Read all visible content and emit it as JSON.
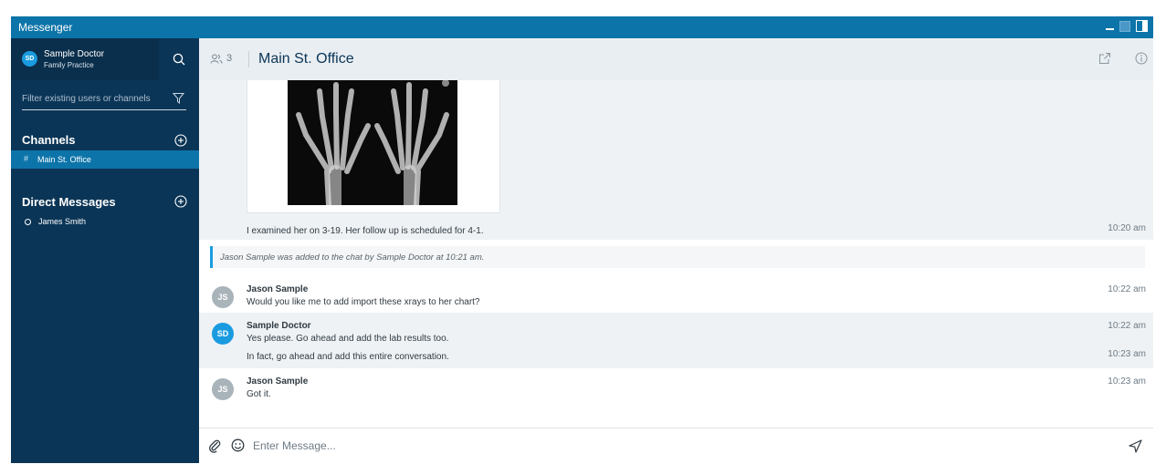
{
  "window": {
    "title": "Messenger"
  },
  "profile": {
    "initials": "SD",
    "name": "Sample Doctor",
    "role": "Family Practice"
  },
  "filter": {
    "placeholder": "Filter existing users or channels"
  },
  "channels": {
    "title": "Channels",
    "items": [
      {
        "label": "Main St. Office"
      }
    ]
  },
  "direct_messages": {
    "title": "Direct Messages",
    "items": [
      {
        "label": "James Smith"
      }
    ]
  },
  "header": {
    "member_count": "3",
    "title": "Main St. Office"
  },
  "messages": [
    {
      "text": "I examined her on 3-19. Her follow up is scheduled for 4-1.",
      "time": "10:20 am"
    },
    {
      "system": "Jason Sample was added to the chat by Sample Doctor at 10:21 am."
    },
    {
      "initials": "JS",
      "sender": "Jason Sample",
      "text": "Would you like me to add import these xrays to her chart?",
      "time": "10:22 am"
    },
    {
      "initials": "SD",
      "sender": "Sample Doctor",
      "text": "Yes please. Go ahead and add the lab results too.",
      "time": "10:22 am",
      "text2": "In fact, go ahead and add this entire conversation.",
      "time2": "10:23 am"
    },
    {
      "initials": "JS",
      "sender": "Jason Sample",
      "text": "Got it.",
      "time": "10:23 am"
    }
  ],
  "composer": {
    "placeholder": "Enter Message..."
  },
  "colors": {
    "titlebar": "#0d74a9",
    "sidebar": "#0b3556",
    "accent": "#1a9be0"
  }
}
